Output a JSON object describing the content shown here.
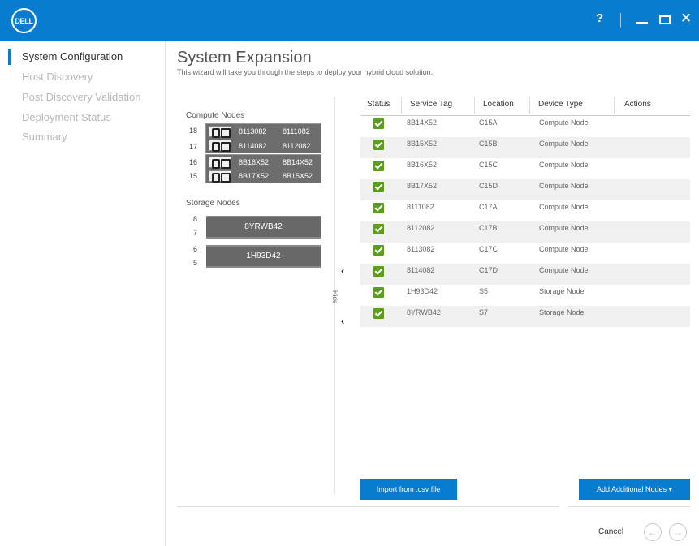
{
  "titlebar": {
    "logo": "DELL",
    "help": "?",
    "close": "✕"
  },
  "sidebar": {
    "items": [
      {
        "label": "System Configuration"
      },
      {
        "label": "Host Discovery"
      },
      {
        "label": "Post Discovery Validation"
      },
      {
        "label": "Deployment Status"
      },
      {
        "label": "Summary"
      }
    ]
  },
  "header": {
    "title": "System Expansion",
    "subtitle": "This wizard will take you through the steps to deploy your hybrid cloud solution."
  },
  "compute": {
    "label": "Compute Nodes",
    "slots": [
      "18",
      "17",
      "16",
      "15"
    ],
    "units": [
      {
        "rows": [
          [
            "8113082",
            "8111082"
          ],
          [
            "8114082",
            "8112082"
          ]
        ]
      },
      {
        "rows": [
          [
            "8B16X52",
            "8B14X52"
          ],
          [
            "8B17X52",
            "8B15X52"
          ]
        ]
      }
    ]
  },
  "storage": {
    "label": "Storage Nodes",
    "slots": [
      "8",
      "7",
      "6",
      "5"
    ],
    "units": [
      "8YRWB42",
      "1H93D42"
    ]
  },
  "toggle": {
    "chevron_top": "‹",
    "hide_label": "Hide",
    "chevron_bottom": "‹"
  },
  "table": {
    "headers": [
      "Status",
      "Service Tag",
      "Location",
      "Device Type",
      "Actions"
    ],
    "rows": [
      {
        "tag": "8B14X52",
        "location": "C15A",
        "type": "Compute Node"
      },
      {
        "tag": "8B15X52",
        "location": "C15B",
        "type": "Compute Node"
      },
      {
        "tag": "8B16X52",
        "location": "C15C",
        "type": "Compute Node"
      },
      {
        "tag": "8B17X52",
        "location": "C15D",
        "type": "Compute Node"
      },
      {
        "tag": "8111082",
        "location": "C17A",
        "type": "Compute Node"
      },
      {
        "tag": "8112082",
        "location": "C17B",
        "type": "Compute Node"
      },
      {
        "tag": "8113082",
        "location": "C17C",
        "type": "Compute Node"
      },
      {
        "tag": "8114082",
        "location": "C17D",
        "type": "Compute Node"
      },
      {
        "tag": "1H93D42",
        "location": "S5",
        "type": "Storage Node"
      },
      {
        "tag": "8YRWB42",
        "location": "S7",
        "type": "Storage Node"
      }
    ]
  },
  "buttons": {
    "import": "Import from .csv file",
    "add": "Add Additional Nodes ▾",
    "cancel": "Cancel",
    "back": "←",
    "next": "→"
  },
  "colors": {
    "accent": "#0a7ccf",
    "check": "#5a9e1e",
    "node_block": "#6d6d6d"
  }
}
